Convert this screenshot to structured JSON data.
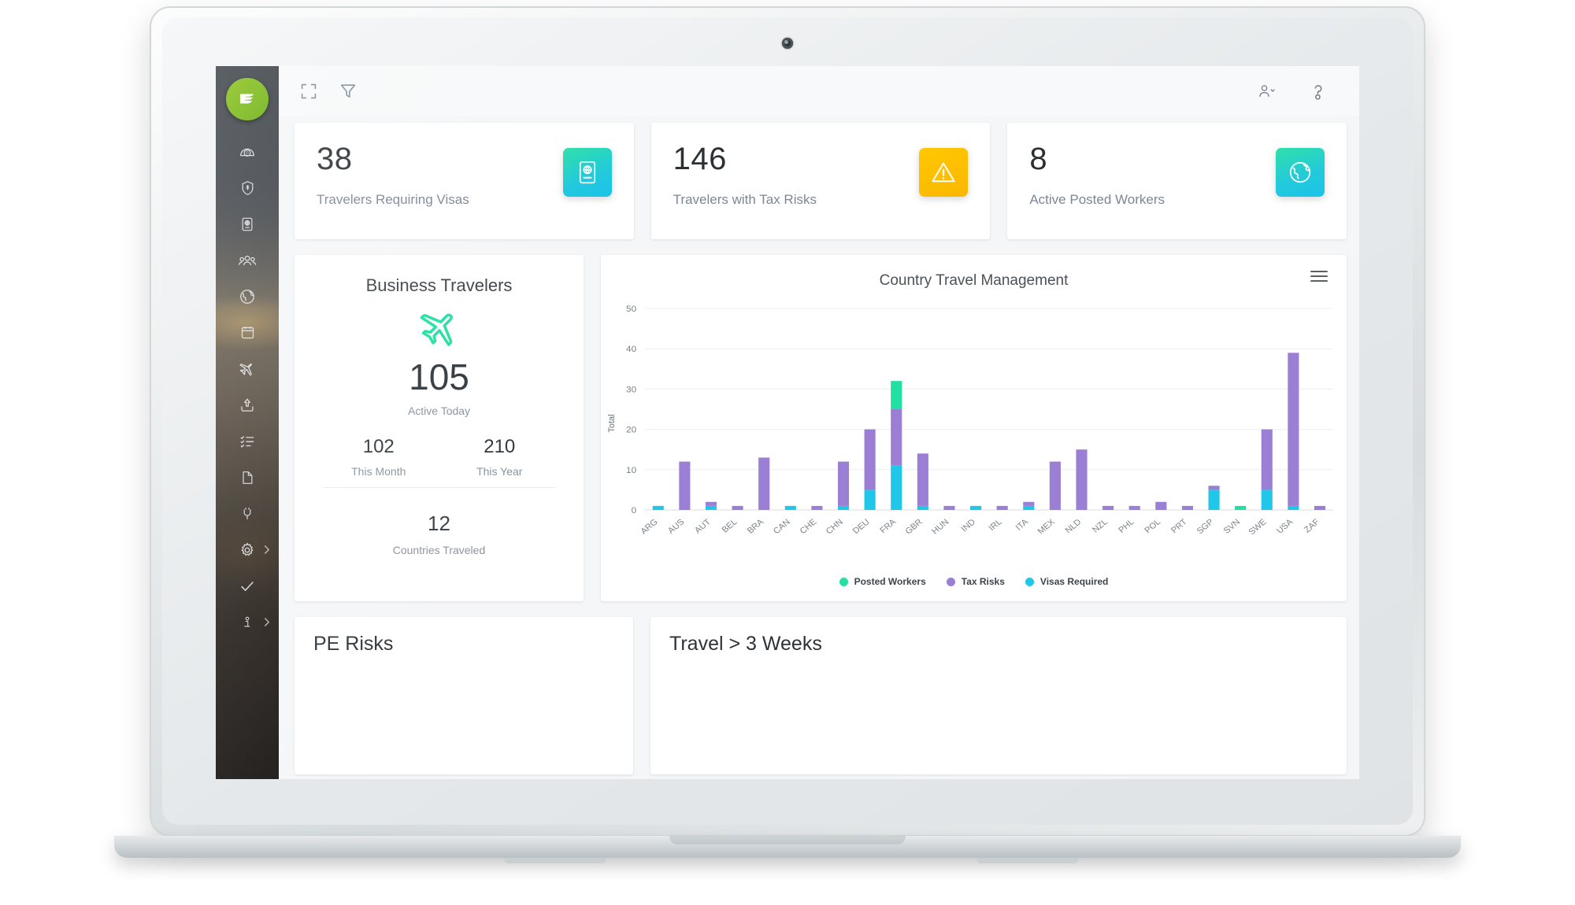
{
  "app": {
    "logo_icon": "brand-logo-icon",
    "accent_green": "#8FC63D",
    "accent_teal": "#22C9DD",
    "accent_amber": "#FFC400",
    "accent_purple": "#9B7FD4",
    "accent_cyan": "#21C7E8",
    "accent_mint": "#22E0A1"
  },
  "toolbar": {
    "expand_icon": "expand-fullscreen-icon",
    "filter_icon": "filter-funnel-icon",
    "user_icon": "user-account-icon",
    "user_chevron_icon": "chevron-down-icon",
    "help_icon": "help-question-icon"
  },
  "sidebar": {
    "items": [
      {
        "name": "dashboard",
        "icon": "gauge-dashboard-icon",
        "chevron": false
      },
      {
        "name": "security",
        "icon": "shield-icon",
        "chevron": false
      },
      {
        "name": "immigration",
        "icon": "passport-icon",
        "chevron": false
      },
      {
        "name": "travelers",
        "icon": "people-group-icon",
        "chevron": false
      },
      {
        "name": "global",
        "icon": "globe-icon",
        "chevron": false
      },
      {
        "name": "calendar",
        "icon": "calendar-icon",
        "chevron": false
      },
      {
        "name": "trips",
        "icon": "airplane-icon",
        "chevron": false
      },
      {
        "name": "uploads",
        "icon": "upload-icon",
        "chevron": false
      },
      {
        "name": "tasks",
        "icon": "checklist-icon",
        "chevron": false
      },
      {
        "name": "documents",
        "icon": "document-icon",
        "chevron": false
      },
      {
        "name": "integrations",
        "icon": "plug-icon",
        "chevron": false
      },
      {
        "name": "settings",
        "icon": "gear-icon",
        "chevron": true
      },
      {
        "name": "approvals",
        "icon": "check-icon",
        "chevron": false
      },
      {
        "name": "info",
        "icon": "info-icon",
        "chevron": true
      }
    ]
  },
  "kpis": [
    {
      "value": "38",
      "label": "Travelers Requiring Visas",
      "icon": "passport-globe-icon",
      "style": "teal"
    },
    {
      "value": "146",
      "label": "Travelers with Tax Risks",
      "icon": "warning-triangle-icon",
      "style": "amber"
    },
    {
      "value": "8",
      "label": "Active Posted Workers",
      "icon": "globe-earth-icon",
      "style": "teal"
    }
  ],
  "business_travelers": {
    "title": "Business Travelers",
    "icon": "airplane-icon",
    "active_value": "105",
    "active_label": "Active Today",
    "month_value": "102",
    "month_label": "This Month",
    "year_value": "210",
    "year_label": "This Year",
    "countries_value": "12",
    "countries_label": "Countries Traveled"
  },
  "chart_panel": {
    "menu_icon": "hamburger-menu-icon"
  },
  "bottom_panels": [
    {
      "title": "PE Risks"
    },
    {
      "title": "Travel > 3 Weeks"
    }
  ],
  "chart_data": {
    "type": "bar",
    "stacked": true,
    "title": "Country Travel Management",
    "xlabel": "",
    "ylabel": "Total",
    "ylim": [
      0,
      50
    ],
    "yticks": [
      0,
      10,
      20,
      30,
      40,
      50
    ],
    "grid": true,
    "legend_position": "bottom",
    "categories": [
      "ARG",
      "AUS",
      "AUT",
      "BEL",
      "BRA",
      "CAN",
      "CHE",
      "CHN",
      "DEU",
      "FRA",
      "GBR",
      "HUN",
      "IND",
      "IRL",
      "ITA",
      "MEX",
      "NLD",
      "NZL",
      "PHL",
      "POL",
      "PRT",
      "SGP",
      "SVN",
      "SWE",
      "USA",
      "ZAF"
    ],
    "series": [
      {
        "name": "Visas Required",
        "color": "#21C7E8",
        "values": [
          1,
          0,
          1,
          0,
          0,
          1,
          0,
          1,
          5,
          11,
          1,
          0,
          1,
          0,
          1,
          0,
          0,
          0,
          0,
          0,
          0,
          5,
          0,
          5,
          1,
          0
        ]
      },
      {
        "name": "Tax Risks",
        "color": "#9B7FD4",
        "values": [
          0,
          12,
          1,
          1,
          13,
          0,
          1,
          11,
          15,
          14,
          13,
          1,
          0,
          1,
          1,
          12,
          15,
          1,
          1,
          2,
          1,
          1,
          0,
          15,
          38,
          1
        ]
      },
      {
        "name": "Posted Workers",
        "color": "#22E0A1",
        "values": [
          0,
          0,
          0,
          0,
          0,
          0,
          0,
          0,
          0,
          7,
          0,
          0,
          0,
          0,
          0,
          0,
          0,
          0,
          0,
          0,
          0,
          0,
          1,
          0,
          0,
          0
        ]
      }
    ]
  }
}
